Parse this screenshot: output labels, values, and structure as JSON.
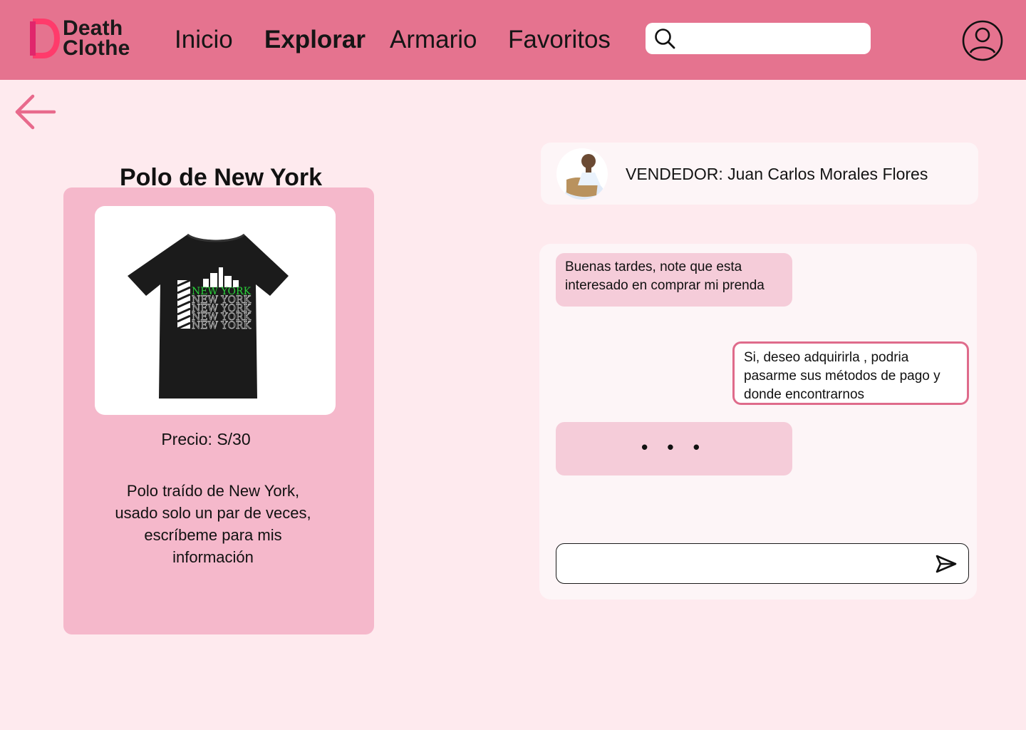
{
  "brand": {
    "name_line1": "Death",
    "name_line2": "Clothe",
    "mark_letter": "D",
    "icon": "logo-d-icon"
  },
  "nav": {
    "items": [
      {
        "label": "Inicio",
        "active": false
      },
      {
        "label": "Explorar",
        "active": true
      },
      {
        "label": "Armario",
        "active": false
      },
      {
        "label": "Favoritos",
        "active": false
      }
    ]
  },
  "search": {
    "placeholder": "",
    "value": "",
    "icon": "search-icon"
  },
  "profile": {
    "icon": "user-circle-icon"
  },
  "back": {
    "icon": "arrow-left-icon"
  },
  "product": {
    "title": "Polo de New York",
    "image_text": "NEW YORK",
    "price": "Precio: S/30",
    "description": "Polo traído de New York, usado solo un par de veces, escríbeme para mis información"
  },
  "seller": {
    "label": "VENDEDOR: Juan Carlos Morales Flores"
  },
  "chat": {
    "messages": [
      {
        "from": "seller",
        "text": "Buenas tardes, note que esta interesado en comprar mi prenda"
      },
      {
        "from": "buyer",
        "text": "Si, deseo adquirirla , podria pasarme sus métodos de pago y donde encontrarnos"
      }
    ],
    "typing_indicator": "• • •",
    "composer_placeholder": "",
    "send_icon": "send-icon"
  },
  "colors": {
    "header": "#e5738f",
    "background": "#feeaee",
    "card": "#f5b8cb",
    "bubble": "#f5ccd9",
    "accent": "#df6b8b",
    "logo_mark": "#ff3b6b"
  }
}
